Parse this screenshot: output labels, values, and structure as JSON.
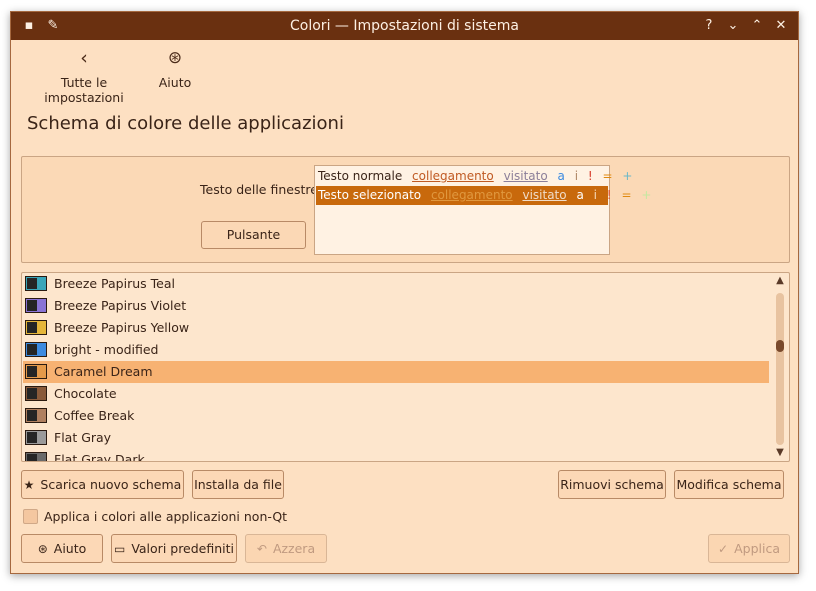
{
  "window": {
    "title": "Colori — Impostazioni di sistema",
    "titlebar_buttons": [
      "?",
      "⌄",
      "⌃",
      "✕"
    ]
  },
  "toolbar": {
    "back_label": "Tutte le impostazioni",
    "help_label": "Aiuto"
  },
  "page_title": "Schema di colore delle applicazioni",
  "preview": {
    "window_text_label": "Testo delle finestre",
    "button_label": "Pulsante",
    "normal_row": {
      "text": "Testo normale",
      "link": "collegamento",
      "visited": "visitato",
      "a": "a",
      "i": "i",
      "excl": "!",
      "eq": "=",
      "plus": "+"
    },
    "selected_row": {
      "text": "Testo selezionato",
      "link": "collegamento",
      "visited": "visitato",
      "a": "a",
      "i": "i",
      "excl": "!",
      "eq": "=",
      "plus": "+"
    }
  },
  "schemes": [
    {
      "name": "Breeze Papirus Teal",
      "accent": "#3aa6b9"
    },
    {
      "name": "Breeze Papirus Violet",
      "accent": "#8a74d6"
    },
    {
      "name": "Breeze Papirus Yellow",
      "accent": "#e5b63a"
    },
    {
      "name": "bright - modified",
      "accent": "#3d8be0"
    },
    {
      "name": "Caramel Dream",
      "accent": "#e59a4a",
      "selected": true
    },
    {
      "name": "Chocolate",
      "accent": "#8a5a3a"
    },
    {
      "name": "Coffee Break",
      "accent": "#b08060"
    },
    {
      "name": "Flat Gray",
      "accent": "#9a9a9a"
    },
    {
      "name": "Flat Gray Dark",
      "accent": "#6a6a6a"
    }
  ],
  "actions": {
    "get_new": "Scarica nuovo schema",
    "install_file": "Installa da file",
    "remove": "Rimuovi schema",
    "edit": "Modifica schema"
  },
  "apply_non_qt_label": "Applica i colori alle applicazioni non-Qt",
  "footer": {
    "help": "Aiuto",
    "defaults": "Valori predefiniti",
    "reset": "Azzera",
    "apply": "Applica"
  }
}
